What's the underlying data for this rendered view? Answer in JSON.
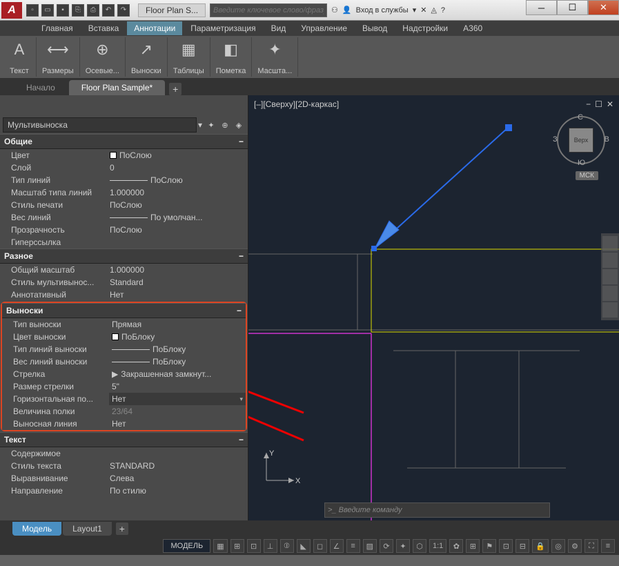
{
  "titlebar": {
    "app_abbr": "A",
    "doc_title": "Floor Plan S...",
    "search_placeholder": "Введите ключевое слово/фразу",
    "login": "Вход в службы",
    "qat_new": "☰",
    "qat_open": "▭",
    "qat_save": "💾",
    "qat_saveas": "⎙",
    "qat_print": "🖨",
    "qat_undo": "↶",
    "qat_redo": "↷",
    "help": "?"
  },
  "menus": [
    "Главная",
    "Вставка",
    "Аннотации",
    "Параметризация",
    "Вид",
    "Управление",
    "Вывод",
    "Надстройки",
    "A360"
  ],
  "menu_active_index": 2,
  "ribbon": [
    {
      "label": "Текст",
      "icon": "A"
    },
    {
      "label": "Размеры",
      "icon": "⟷"
    },
    {
      "label": "Осевые...",
      "icon": "⊕"
    },
    {
      "label": "Выноски",
      "icon": "↗"
    },
    {
      "label": "Таблицы",
      "icon": "▦"
    },
    {
      "label": "Пометка",
      "icon": "◧"
    },
    {
      "label": "Масшта...",
      "icon": "✦"
    }
  ],
  "doctabs": {
    "start": "Начало",
    "active": "Floor Plan Sample*"
  },
  "props": {
    "type": "Мультивыноска",
    "sections": {
      "general": {
        "title": "Общие",
        "color_lbl": "Цвет",
        "color": "ПоСлою",
        "layer_lbl": "Слой",
        "layer": "0",
        "ltype_lbl": "Тип линий",
        "ltype": "ПоСлою",
        "lscale_lbl": "Масштаб типа линий",
        "lscale": "1.000000",
        "pstyle_lbl": "Стиль печати",
        "pstyle": "ПоСлою",
        "lweight_lbl": "Вес линий",
        "lweight": "По умолчан...",
        "transp_lbl": "Прозрачность",
        "transp": "ПоСлою",
        "hyper_lbl": "Гиперссылка",
        "hyper": ""
      },
      "misc": {
        "title": "Разное",
        "scale_lbl": "Общий масштаб",
        "scale": "1.000000",
        "style_lbl": "Стиль мультивынос...",
        "style": "Standard",
        "anno_lbl": "Аннотативный",
        "anno": "Нет"
      },
      "leaders": {
        "title": "Выноски",
        "type_lbl": "Тип выноски",
        "type": "Прямая",
        "color_lbl": "Цвет выноски",
        "color": "ПоБлоку",
        "ltype_lbl": "Тип линий выноски",
        "ltype": "ПоБлоку",
        "lweight_lbl": "Вес линий выноски",
        "lweight": "ПоБлоку",
        "arrow_lbl": "Стрелка",
        "arrow": "Закрашенная замкнут...",
        "arrowsz_lbl": "Размер стрелки",
        "arrowsz": "5\"",
        "hland_lbl": "Горизонтальная по...",
        "hland": "Нет",
        "landsz_lbl": "Величина полки",
        "landsz": "23/64",
        "extline_lbl": "Выносная линия",
        "extline": "Нет"
      },
      "text": {
        "title": "Текст",
        "content_lbl": "Содержимое",
        "content": "",
        "tstyle_lbl": "Стиль текста",
        "tstyle": "STANDARD",
        "justify_lbl": "Выравнивание",
        "justify": "Слева",
        "dir_lbl": "Направление",
        "dir": "По стилю"
      }
    }
  },
  "canvas": {
    "title": "[–][Сверху][2D-каркас]",
    "viewcube_top": "Верх",
    "dir_n": "С",
    "dir_s": "Ю",
    "dir_w": "З",
    "dir_e": "В",
    "wcs": "МСК",
    "ucs_y": "Y",
    "ucs_x": "X",
    "cmd_placeholder": "Введите команду",
    "cmd_prompt": ">_"
  },
  "bottom_tabs": {
    "model": "Модель",
    "layout": "Layout1"
  },
  "status": {
    "model": "МОДЕЛЬ",
    "scale": "1:1"
  }
}
